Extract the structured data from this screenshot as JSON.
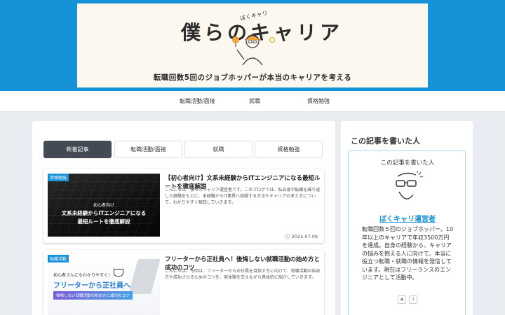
{
  "header": {
    "small_text": "ぼくキャリ",
    "site_title": "僕らのキャリア",
    "tagline": "転職回数5回のジョブホッパーが本当のキャリアを考える"
  },
  "nav": {
    "items": [
      "転職活動/面接",
      "就職",
      "資格勉強"
    ]
  },
  "tabs": [
    {
      "label": "新着記事",
      "active": true
    },
    {
      "label": "転職活動/面接",
      "active": false
    },
    {
      "label": "就職",
      "active": false
    },
    {
      "label": "資格勉強",
      "active": false
    }
  ],
  "posts": [
    {
      "category": "資格勉強",
      "thumb_lines": [
        "初心者向け",
        "文系未経験からITエンジニアになる",
        "最短ルートを徹底解説"
      ],
      "title": "【初心者向け】文系未経験からITエンジニアになる最短ルートを徹底解説",
      "excerpt": "こんにちは、僕らのキャリア運営者です。このブログでは、私自身が転職を繰り返した経験をもとに、未経験からIT業界へ挑戦する方法やキャリアの考え方について、わかりやすく解説していきます。",
      "date": "2025.07.09"
    },
    {
      "category": "転職活動",
      "thumb_lines": [
        "初心者さんにもわかりやすく！",
        "フリーターから正社員へ",
        "後悔しない就職活動の始め方と成功のコツ"
      ],
      "title": "フリーターから正社員へ！後悔しない就職活動の始め方と成功のコツ",
      "excerpt": "こんにちは。今回は、フリーターから正社員を目指す方に向けて、就職活動の始め方や成功させるためのコツを、実体験を交えながら具体的に紹介していきます。"
    }
  ],
  "sidebar": {
    "heading": "この記事を書いた人",
    "profile_title": "この記事を書いた人",
    "author_name": "ぼくキャリ運営者",
    "description": "転職回数５回のジョブホッパー。10年以上のキャリアで年収3500万円を達成。自身の経験から、キャリアの悩みを抱える人に向けて、本当に役立つ転職・就職の情報を発信しています。現在はフリーランスのエンジニアとして活動中。"
  },
  "colors": {
    "brand_blue": "#1693d8",
    "active_tab": "#434a54",
    "background": "#e9edf1"
  }
}
